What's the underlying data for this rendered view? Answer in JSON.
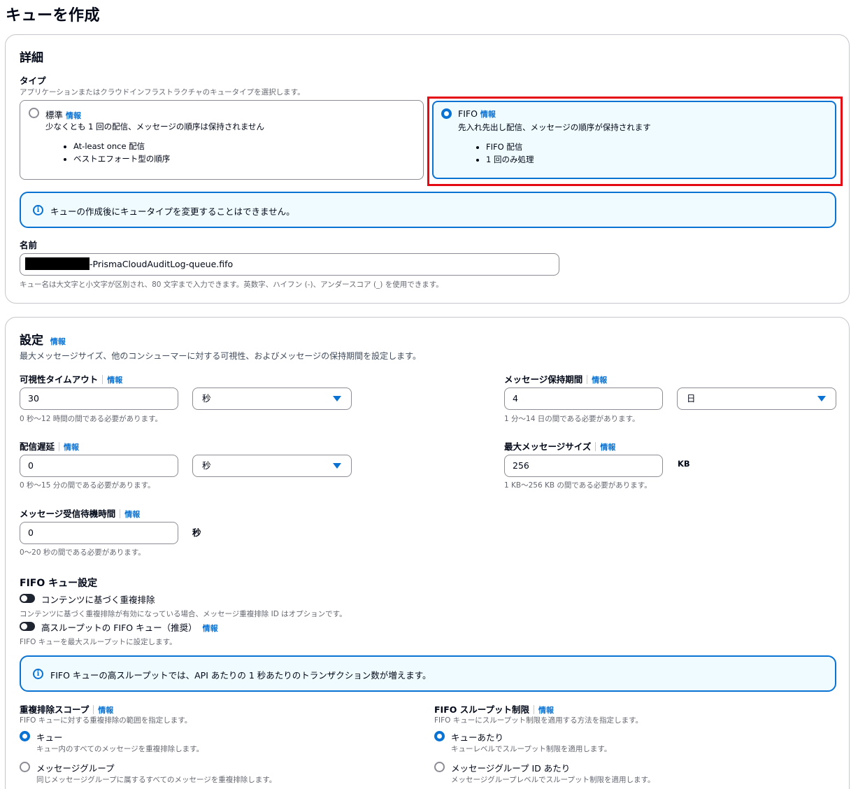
{
  "page": {
    "title": "キューを作成"
  },
  "details": {
    "heading": "詳細",
    "type": {
      "label": "タイプ",
      "description": "アプリケーションまたはクラウドインフラストラクチャのキュータイプを選択します。",
      "options": [
        {
          "title": "標準",
          "info": "情報",
          "description": "少なくとも 1 回の配信、メッセージの順序は保持されません",
          "bullets": [
            "At-least once 配信",
            "ベストエフォート型の順序"
          ],
          "selected": false
        },
        {
          "title": "FIFO",
          "info": "情報",
          "description": "先入れ先出し配信、メッセージの順序が保持されます",
          "bullets": [
            "FIFO 配信",
            "1 回のみ処理"
          ],
          "selected": true
        }
      ]
    },
    "alert": "キューの作成後にキュータイプを変更することはできません。",
    "name": {
      "label": "名前",
      "value": "-PrismaCloudAuditLog-queue.fifo",
      "hint": "キュー名は大文字と小文字が区別され、80 文字まで入力できます。英数字、ハイフン (-)、アンダースコア (_) を使用できます。"
    }
  },
  "settings": {
    "heading": "設定",
    "info": "情報",
    "description": "最大メッセージサイズ、他のコンシューマーに対する可視性、およびメッセージの保持期間を設定します。",
    "visibility_timeout": {
      "label": "可視性タイムアウト",
      "info": "情報",
      "value": "30",
      "unit": "秒",
      "hint": "0 秒～12 時間の間である必要があります。"
    },
    "retention_period": {
      "label": "メッセージ保持期間",
      "info": "情報",
      "value": "4",
      "unit": "日",
      "hint": "1 分～14 日の間である必要があります。"
    },
    "delivery_delay": {
      "label": "配信遅延",
      "info": "情報",
      "value": "0",
      "unit": "秒",
      "hint": "0 秒～15 分の間である必要があります。"
    },
    "max_message_size": {
      "label": "最大メッセージサイズ",
      "info": "情報",
      "value": "256",
      "unit": "KB",
      "hint": "1 KB～256 KB の間である必要があります。"
    },
    "receive_wait": {
      "label": "メッセージ受信待機時間",
      "info": "情報",
      "value": "0",
      "unit": "秒",
      "hint": "0～20 秒の間である必要があります。"
    },
    "fifo": {
      "heading": "FIFO キュー設定",
      "content_dedup": {
        "label": "コンテンツに基づく重複排除",
        "hint": "コンテンツに基づく重複排除が有効になっている場合、メッセージ重複排除 ID はオプションです。",
        "enabled": false
      },
      "high_throughput": {
        "label": "高スループットの FIFO キュー（推奨）",
        "info": "情報",
        "hint": "FIFO キューを最大スループットに設定します。",
        "enabled": false
      },
      "alert": "FIFO キューの高スループットでは、API あたりの 1 秒あたりのトランザクション数が増えます。",
      "dedup_scope": {
        "label": "重複排除スコープ",
        "info": "情報",
        "description": "FIFO キューに対する重複排除の範囲を指定します。",
        "options": [
          {
            "label": "キュー",
            "hint": "キュー内のすべてのメッセージを重複排除します。",
            "selected": true
          },
          {
            "label": "メッセージグループ",
            "hint": "同じメッセージグループに属するすべてのメッセージを重複排除します。",
            "selected": false
          }
        ]
      },
      "throughput_limit": {
        "label": "FIFO スループット制限",
        "info": "情報",
        "description": "FIFO キューにスループット制限を適用する方法を指定します。",
        "options": [
          {
            "label": "キューあたり",
            "hint": "キューレベルでスループット制限を適用します。",
            "selected": true
          },
          {
            "label": "メッセージグループ ID あたり",
            "hint": "メッセージグループレベルでスループット制限を適用します。",
            "selected": false
          }
        ]
      }
    }
  },
  "colors": {
    "accent": "#0972d3",
    "highlight": "#e50914",
    "alert_bg": "#f0fbff"
  }
}
